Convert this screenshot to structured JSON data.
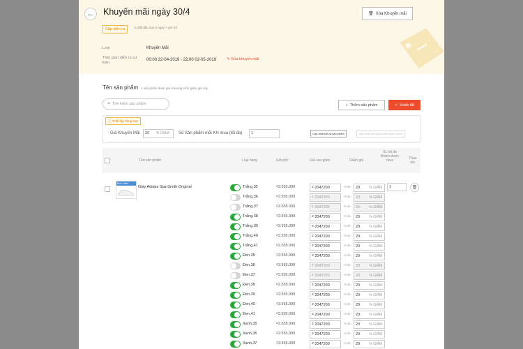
{
  "header": {
    "title": "Khuyến mãi ngày 30/4",
    "status_badge": "Sắp diễn ra",
    "starts_in": "Bắt đầu sau 8 ngày 7 giờ tới",
    "delete_label": "Xóa Khuyến mãi",
    "type_label": "Loại",
    "type_value": "Khuyến Mãi",
    "time_label": "Thời gian diễn ra sự kiện",
    "time_value": "00:00 22-04-2019 - 22:00 02-05-2019",
    "edit_label": "Sửa khuyến mãi"
  },
  "products_section": {
    "title": "Tên sản phẩm",
    "note": "1 sản phẩm tham gia chương trình giảm giá này",
    "search_placeholder": "Tìm kiếm sản phẩm",
    "add_label": "Thêm sản phẩm",
    "done_label": "Hoàn tất"
  },
  "bulk": {
    "badge": "Thiết lập hàng loạt",
    "discount_label": "Giá Khuyến Mãi",
    "discount_value": "20",
    "discount_unit": "% GIẢM",
    "limit_label": "Số Sản phẩm mỗi KH mua (tối đa)",
    "limit_value": "1",
    "update_all_label": "Cập nhật tất cả sản phẩm",
    "update_selected_label": "Cập nhật các sản phẩm được chọn"
  },
  "table": {
    "headers": {
      "name": "Tên sản phẩm",
      "variant": "Loại hàng",
      "orig_price": "Giá gốc",
      "sale_price": "Giá sau giảm",
      "discount": "Giảm giá",
      "limit": "SL tối đa khách được mua",
      "action": "Thao tác"
    },
    "product_name": "Giày Adidas StanSmith Original",
    "thumb_text": "Mua nhiều",
    "limit_value": "1",
    "or_text": "Hoặc",
    "discount_unit": "% GIẢM",
    "rows": [
      {
        "variant": "Trắng,35",
        "price": "₫2.555.000",
        "sale": "₫ 2047200",
        "pct": "20",
        "on": true
      },
      {
        "variant": "Trắng,36",
        "price": "₫2.555.000",
        "sale": "₫ 2047200",
        "pct": "20",
        "on": false
      },
      {
        "variant": "Trắng,37",
        "price": "₫2.555.000",
        "sale": "₫ 2047200",
        "pct": "20",
        "on": false
      },
      {
        "variant": "Trắng,38",
        "price": "₫2.555.000",
        "sale": "₫ 2047200",
        "pct": "20",
        "on": true
      },
      {
        "variant": "Trắng,39",
        "price": "₫2.555.000",
        "sale": "₫ 2047200",
        "pct": "20",
        "on": true
      },
      {
        "variant": "Trắng,40",
        "price": "₫2.555.000",
        "sale": "₫ 2047200",
        "pct": "20",
        "on": true
      },
      {
        "variant": "Trắng,41",
        "price": "₫2.555.000",
        "sale": "₫ 2047200",
        "pct": "20",
        "on": true
      },
      {
        "variant": "Đen,35",
        "price": "₫2.555.000",
        "sale": "₫ 2047200",
        "pct": "20",
        "on": true
      },
      {
        "variant": "Đen,36",
        "price": "₫2.555.000",
        "sale": "₫ 2047200",
        "pct": "20",
        "on": false
      },
      {
        "variant": "Đen,37",
        "price": "₫2.555.000",
        "sale": "₫ 2047200",
        "pct": "20",
        "on": false
      },
      {
        "variant": "Đen,38",
        "price": "₫2.555.000",
        "sale": "₫ 2047200",
        "pct": "20",
        "on": true
      },
      {
        "variant": "Đen,39",
        "price": "₫2.555.000",
        "sale": "₫ 2047200",
        "pct": "20",
        "on": true
      },
      {
        "variant": "Đen,40",
        "price": "₫2.555.000",
        "sale": "₫ 2047200",
        "pct": "20",
        "on": true
      },
      {
        "variant": "Đen,41",
        "price": "₫2.555.000",
        "sale": "₫ 2047200",
        "pct": "20",
        "on": true
      },
      {
        "variant": "Xanh,35",
        "price": "₫2.555.000",
        "sale": "₫ 2047200",
        "pct": "20",
        "on": true
      },
      {
        "variant": "Xanh,36",
        "price": "₫2.555.000",
        "sale": "₫ 2047200",
        "pct": "20",
        "on": true
      },
      {
        "variant": "Xanh,37",
        "price": "₫2.555.000",
        "sale": "₫ 2047200",
        "pct": "20",
        "on": true
      }
    ]
  },
  "colors": {
    "accent": "#ee4d2d",
    "toggle_on": "#2aa83a",
    "header_bg": "#fdf7e7"
  }
}
